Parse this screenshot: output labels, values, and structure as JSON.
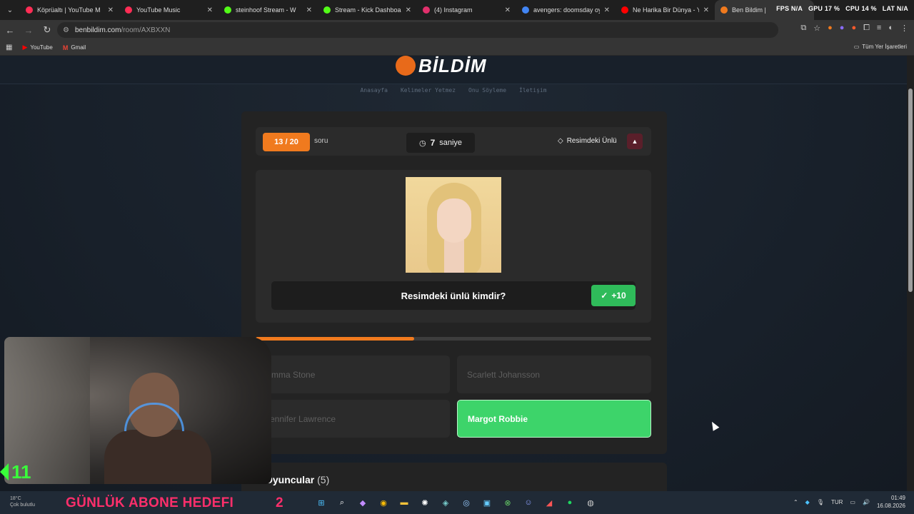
{
  "browser": {
    "tabs": [
      {
        "title": "Köprüaltı | YouTube M",
        "color": "#ff2d55"
      },
      {
        "title": "YouTube Music",
        "color": "#ff2d55"
      },
      {
        "title": "steinhoof Stream - W",
        "color": "#53fc18"
      },
      {
        "title": "Stream - Kick Dashboard",
        "color": "#53fc18"
      },
      {
        "title": "(4) Instagram",
        "color": "#e1306c"
      },
      {
        "title": "avengers: doomsday oyu",
        "color": "#4285f4"
      },
      {
        "title": "Ne Harika Bir Dünya - You",
        "color": "#ff0000"
      },
      {
        "title": "Ben Bildim |",
        "color": "#f07a1e"
      }
    ],
    "system_overlay": [
      "FPS N/A",
      "GPU 17 %",
      "CPU 14 %",
      "LAT N/A"
    ],
    "url_host": "benbildim.com",
    "url_path": "/room/AXBXXN",
    "bookmarks": [
      {
        "label": "YouTube",
        "icon": "youtube-icon"
      },
      {
        "label": "Gmail",
        "icon": "gmail-icon"
      }
    ],
    "all_bookmarks": "Tüm Yer İşaretleri"
  },
  "site": {
    "logo_text": "BİLDİM",
    "nav": [
      "Anasayfa",
      "Kelimeler Yetmez",
      "Onu Söyleme",
      "İletişim"
    ]
  },
  "game": {
    "question_counter": "13 / 20",
    "question_counter_label": "soru",
    "timer_value": "7",
    "timer_unit": "saniye",
    "category": "Resimdeki Ünlü",
    "question": "Resimdeki ünlü kimdir?",
    "points": "+10",
    "progress_fraction": 0.4,
    "options": [
      {
        "label": "Emma Stone",
        "correct": false
      },
      {
        "label": "Scarlett Johansson",
        "correct": false
      },
      {
        "label": "Jennifer Lawrence",
        "correct": false
      },
      {
        "label": "Margot Robbie",
        "correct": true
      }
    ],
    "players_title": "Oyuncular",
    "players_count": "(5)"
  },
  "stream_overlay": {
    "counter": "11",
    "goal_text": "GÜNLÜK ABONE HEDEFI",
    "goal_value": "2"
  },
  "taskbar": {
    "weather_temp": "18°C",
    "weather_desc": "Çok bulutlu",
    "lang": "TUR",
    "time": "01:49",
    "date": "16.08.2026"
  }
}
